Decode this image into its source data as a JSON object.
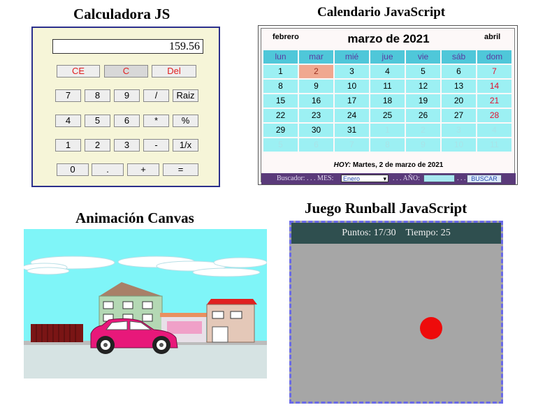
{
  "titles": {
    "calc": "Calculadora JS",
    "calendar": "Calendario JavaScript",
    "canvas": "Animación Canvas",
    "runball": "Juego Runball JavaScript"
  },
  "calculator": {
    "display": "159.56",
    "row1": [
      "CE",
      "C",
      "Del"
    ],
    "row2": [
      "7",
      "8",
      "9",
      "/",
      "Raiz"
    ],
    "row3": [
      "4",
      "5",
      "6",
      "*",
      "%"
    ],
    "row4": [
      "1",
      "2",
      "3",
      "-",
      "1/x"
    ],
    "row5": [
      "0",
      ".",
      "+",
      "="
    ]
  },
  "calendar": {
    "prev": "febrero",
    "month": "marzo de 2021",
    "next": "abril",
    "weekdays": [
      "lun",
      "mar",
      "mié",
      "jue",
      "vie",
      "sáb",
      "dom"
    ],
    "weeks": [
      [
        "1",
        "2",
        "3",
        "4",
        "5",
        "6",
        "7"
      ],
      [
        "8",
        "9",
        "10",
        "11",
        "12",
        "13",
        "14"
      ],
      [
        "15",
        "16",
        "17",
        "18",
        "19",
        "20",
        "21"
      ],
      [
        "22",
        "23",
        "24",
        "25",
        "26",
        "27",
        "28"
      ],
      [
        "29",
        "30",
        "31",
        "1",
        "2",
        "3",
        "4"
      ],
      [
        "5",
        "6",
        "7",
        "8",
        "9",
        "10",
        "11"
      ]
    ],
    "today_label": "HOY:",
    "today_text": "Martes, 2 de marzo de 2021",
    "search_label": "Buscador: . . . MES:",
    "month_select": "Enero",
    "year_label": ". . . AÑO:",
    "dots": ". . .",
    "search_button": "BUSCAR"
  },
  "runball": {
    "score": "Puntos: 17/30",
    "time": "Tiempo: 25"
  },
  "colors": {
    "calc_bg": "#f6f5d8",
    "calc_border": "#2b2f8c",
    "cal_header": "#4fc7d9",
    "cal_cell": "#9cf0f3",
    "cal_today": "#f0a890",
    "run_bg": "#a6a6a6",
    "run_header": "#2f4f4f",
    "ball": "#ee0b0b"
  }
}
